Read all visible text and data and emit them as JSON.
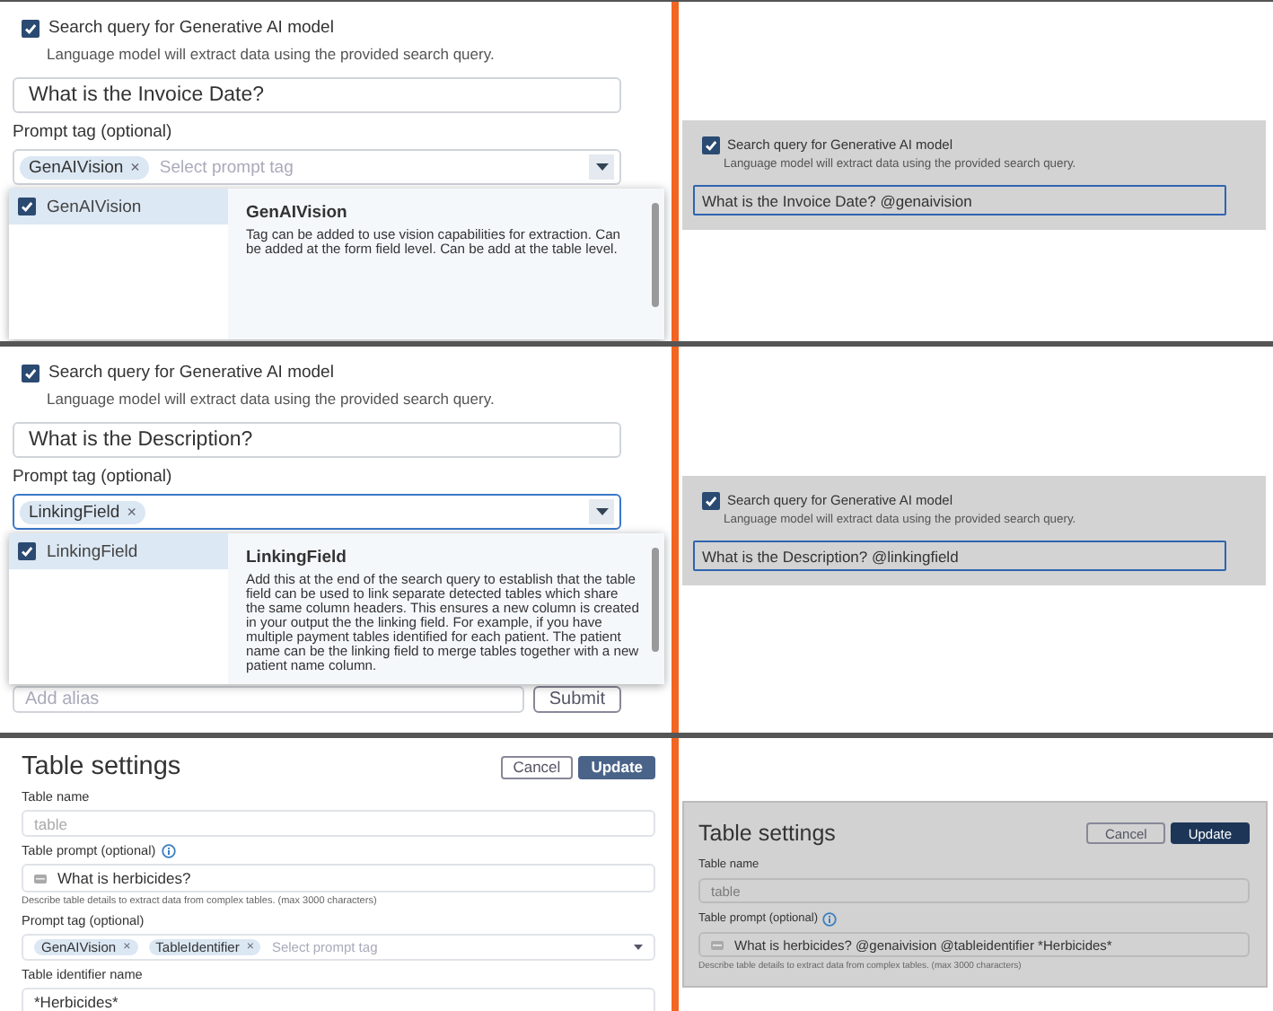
{
  "rows": [
    {
      "left": {
        "kind": "query",
        "dimmed": false,
        "checkbox": {
          "label": "Search query for Generative AI model",
          "checked": true
        },
        "hint": "Language model will extract data using the provided search query.",
        "query": {
          "value": "What is the Invoice Date?",
          "focused": false
        },
        "tag_label": "Prompt tag (optional)",
        "tag_field": {
          "tags": [
            {
              "label": "GenAIVision",
              "remove": "×"
            }
          ],
          "placeholder": "Select prompt tag",
          "focused": false
        },
        "dropdown": {
          "options": [
            {
              "label": "GenAIVision",
              "checked": true,
              "selected": true
            }
          ],
          "detail": {
            "title": "GenAIVision",
            "text": "Tag can be added to use vision capabilities for extraction. Can be added at the form field level. Can be add at the table level."
          }
        }
      },
      "right": {
        "kind": "query",
        "dimmed": true,
        "checkbox": {
          "label": "Search query for Generative AI model",
          "checked": true
        },
        "hint": "Language model will extract data using the provided search query.",
        "query": {
          "value": "What is the Invoice Date? @genaivision",
          "focused": true
        }
      }
    },
    {
      "left": {
        "kind": "query",
        "dimmed": false,
        "checkbox": {
          "label": "Search query for Generative AI model",
          "checked": true
        },
        "hint": "Language model will extract data using the provided search query.",
        "query": {
          "value": "What is the Description?",
          "focused": false
        },
        "tag_label": "Prompt tag (optional)",
        "tag_field": {
          "tags": [
            {
              "label": "LinkingField",
              "remove": "×"
            }
          ],
          "focused": true
        },
        "alias": {
          "placeholder": "Add alias",
          "button": "Submit"
        },
        "dropdown": {
          "options": [
            {
              "label": "LinkingField",
              "checked": true,
              "selected": true
            }
          ],
          "detail": {
            "title": "LinkingField",
            "text": "Add this at the end of the search query to establish that the table field can be used to link separate detected tables which share the same column headers. This ensures a new column is created in your output the the linking field. For example, if you have multiple payment tables identified for each patient. The patient name can be the linking field to merge tables together with a new patient name column."
          }
        }
      },
      "right": {
        "kind": "query",
        "dimmed": true,
        "checkbox": {
          "label": "Search query for Generative AI model",
          "checked": true
        },
        "hint": "Language model will extract data using the provided search query.",
        "query": {
          "value": "What is the Description? @linkingfield",
          "focused": true
        }
      }
    },
    {
      "left": {
        "kind": "table",
        "dimmed": false,
        "title": "Table settings",
        "buttons": [
          {
            "label": "Cancel",
            "kind": "secondary"
          },
          {
            "label": "Update",
            "kind": "primary"
          }
        ],
        "fields": [
          {
            "kind": "text",
            "label": "Table name",
            "placeholder": "table"
          },
          {
            "kind": "prompt",
            "label": "Table prompt (optional)",
            "info": true,
            "value": "What is herbicides?",
            "hint": "Describe table details to extract data from complex tables. (max 3000 characters)"
          },
          {
            "kind": "tags",
            "label": "Prompt tag (optional)",
            "tags": [
              {
                "label": "GenAIVision",
                "remove": "×"
              },
              {
                "label": "TableIdentifier",
                "remove": "×"
              }
            ],
            "placeholder": "Select prompt tag"
          },
          {
            "kind": "text",
            "label": "Table identifier name",
            "value": "*Herbicides*"
          }
        ]
      },
      "right": {
        "kind": "table",
        "dimmed": true,
        "title": "Table settings",
        "buttons": [
          {
            "label": "Cancel",
            "kind": "secondary"
          },
          {
            "label": "Update",
            "kind": "primary"
          }
        ],
        "fields": [
          {
            "kind": "text",
            "label": "Table name",
            "placeholder": "table"
          },
          {
            "kind": "prompt",
            "label": "Table prompt (optional)",
            "info": true,
            "value": "What is herbicides? @genaivision @tableidentifier *Herbicides*",
            "hint": "Describe table details to extract data from complex tables. (max 3000 characters)"
          }
        ]
      }
    }
  ]
}
